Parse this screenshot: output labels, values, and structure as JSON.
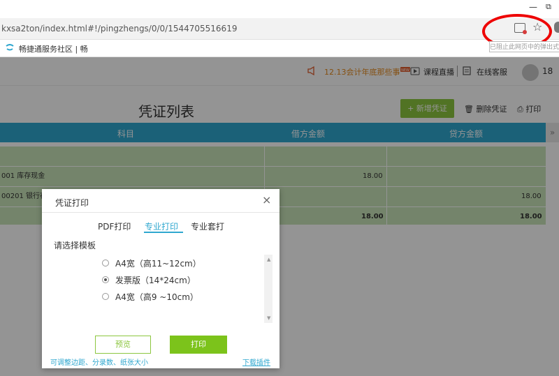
{
  "browser": {
    "url": "kxsa2ton/index.html#!/pingzhengs/0/0/1544705516619",
    "bookmark_label": "畅捷通服务社区 | 畅",
    "tooltip_text": "已阻止此网页中的弹出式窗口",
    "minimize_glyph": "—",
    "restore_glyph": "⧉",
    "star_glyph": "☆"
  },
  "header": {
    "notice": "12.13会计年底那些事",
    "live": "课程直播",
    "service": "在线客服",
    "user_num": "18"
  },
  "page": {
    "title": "凭证列表",
    "new_button": "+ 新增凭证",
    "delete_button": "删除凭证",
    "print_button": "打印"
  },
  "table": {
    "columns": [
      "科目",
      "借方金额",
      "贷方金额"
    ],
    "rows": [
      {
        "subject": "",
        "debit": "",
        "credit": ""
      },
      {
        "subject": "001 库存现金",
        "debit": "18.00",
        "credit": ""
      },
      {
        "subject": "00201 银行存",
        "debit": "",
        "credit": "18.00"
      },
      {
        "subject": "",
        "debit": "18.00",
        "credit": "18.00"
      }
    ],
    "collapse_glyph": "»"
  },
  "dialog": {
    "title": "凭证打印",
    "close_glyph": "×",
    "tabs": [
      "PDF打印",
      "专业打印",
      "专业套打"
    ],
    "template_label": "请选择模板",
    "options": [
      {
        "label": "A4宽（高11~12cm）",
        "selected": false
      },
      {
        "label": "发票版（14*24cm）",
        "selected": true
      },
      {
        "label": "A4宽（高9 ~10cm）",
        "selected": false
      }
    ],
    "preview_button": "预览",
    "print_button": "打印",
    "adjust_link": "可调整边距、分录数、纸张大小",
    "download_link": "下载插件",
    "scroll_up_glyph": "▲",
    "scroll_down_glyph": "▼"
  },
  "colors": {
    "accent_blue": "#2fa7cf",
    "accent_green": "#8cc63f",
    "row_green": "#c9e4b8",
    "annotation_red": "#ee0000"
  }
}
